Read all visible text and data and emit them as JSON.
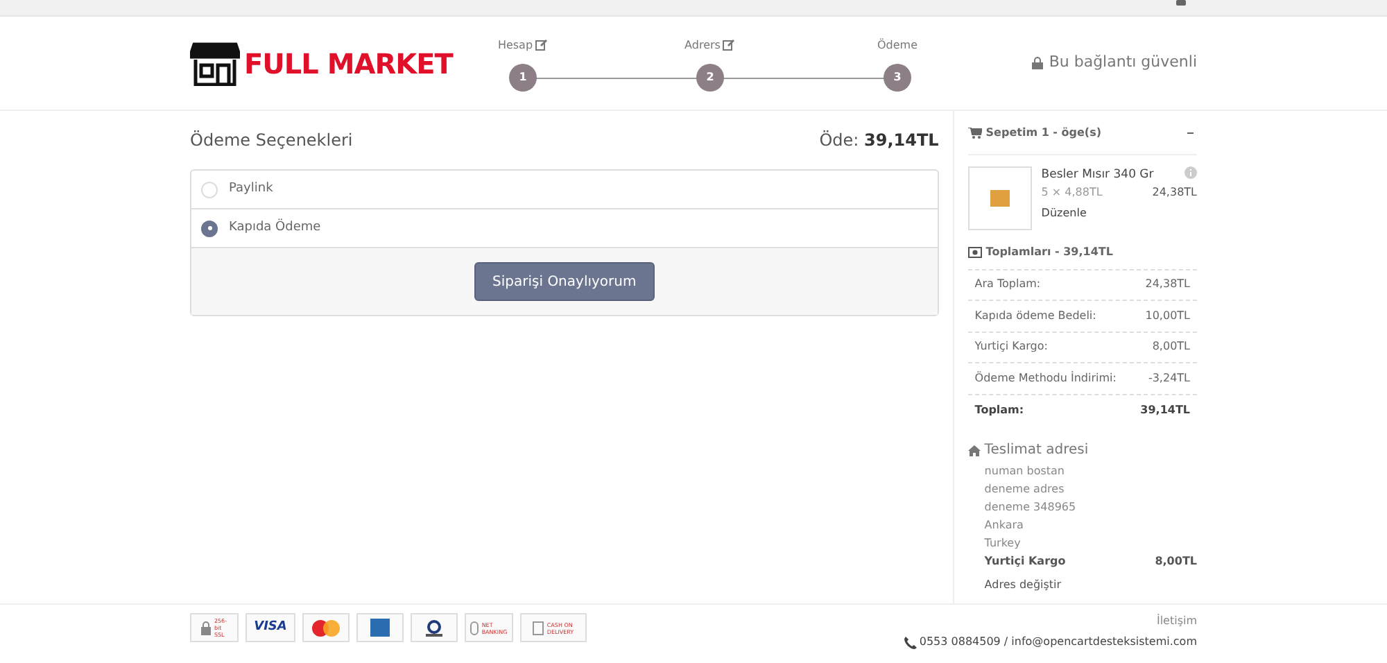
{
  "header": {
    "logo": "FULL MARKET",
    "steps": [
      {
        "label": "Hesap",
        "number": "1",
        "editable": true
      },
      {
        "label": "Adrers",
        "number": "2",
        "editable": true
      },
      {
        "label": "Ödeme",
        "number": "3",
        "editable": false
      }
    ],
    "secure_note": "Bu bağlantı güvenli"
  },
  "payment": {
    "title": "Ödeme Seçenekleri",
    "total_label": "Öde:",
    "total": "39,14TL",
    "options": [
      {
        "label": "Paylink",
        "selected": false
      },
      {
        "label": "Kapıda Ödeme",
        "selected": true
      }
    ],
    "confirm_button": "Siparişi Onaylıyorum"
  },
  "cart": {
    "title": "Sepetim 1 - öge(s)",
    "collapse": "–",
    "items": [
      {
        "name": "Besler Mısır 340 Gr",
        "qty_price": "5 × 4,88TL",
        "total": "24,38TL",
        "edit": "Düzenle"
      }
    ],
    "totals_title": "Toplamları - 39,14TL",
    "totals": [
      {
        "label": "Ara Toplam:",
        "value": "24,38TL",
        "bold": false
      },
      {
        "label": "Kapıda ödeme Bedeli:",
        "value": "10,00TL",
        "bold": false
      },
      {
        "label": "Yurtiçi Kargo:",
        "value": "8,00TL",
        "bold": false
      },
      {
        "label": "Ödeme Methodu İndirimi:",
        "value": "-3,24TL",
        "bold": false
      },
      {
        "label": "Toplam:",
        "value": "39,14TL",
        "bold": true
      }
    ]
  },
  "shipping": {
    "title": "Teslimat adresi",
    "address_lines": [
      "numan bostan",
      "deneme adres",
      "deneme 348965",
      "Ankara",
      "Turkey"
    ],
    "method": "Yurtiçi Kargo",
    "method_price": "8,00TL",
    "change_link": "Adres değiştir"
  },
  "footer": {
    "badges": [
      {
        "kind": "ssl",
        "label": "256-bit SSL"
      },
      {
        "kind": "visa",
        "label": "VISA"
      },
      {
        "kind": "mastercard"
      },
      {
        "kind": "amex"
      },
      {
        "kind": "diners"
      },
      {
        "kind": "netbanking",
        "label": "NET BANKING"
      },
      {
        "kind": "cod",
        "label": "CASH ON DELIVERY"
      }
    ],
    "contact_title": "İletişim",
    "contact": "0553 0884509 / info@opencartdesteksistemi.com"
  }
}
